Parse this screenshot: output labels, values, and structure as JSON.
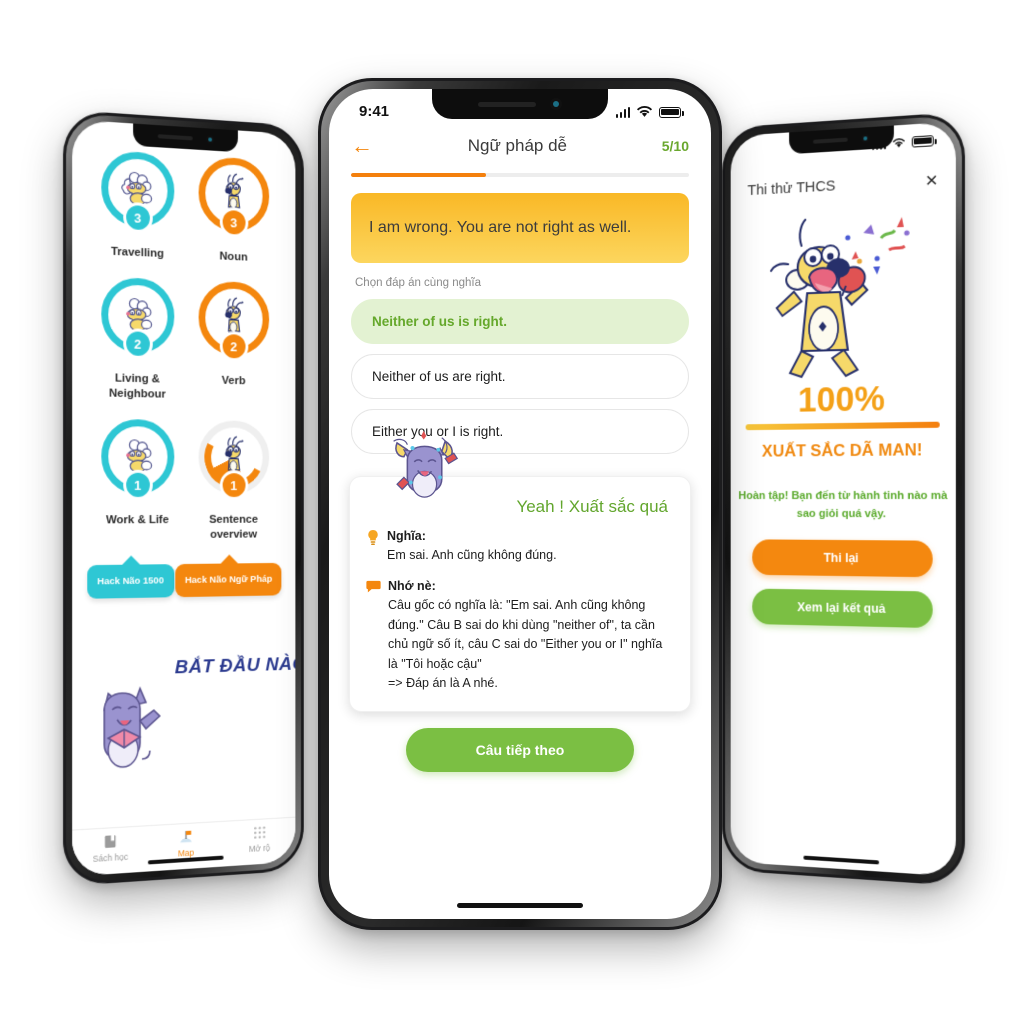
{
  "left_phone": {
    "screen_name": "map-screen",
    "nodes": [
      {
        "label": "Travelling",
        "badge": "3",
        "color": "#2ec7d4",
        "state": "complete",
        "mascot": "sheep-icon"
      },
      {
        "label": "Noun",
        "badge": "3",
        "color": "#f4870e",
        "state": "complete",
        "mascot": "dog-icon"
      },
      {
        "label": "Living & Neighbour",
        "badge": "2",
        "color": "#2ec7d4",
        "state": "complete",
        "mascot": "sheep-icon"
      },
      {
        "label": "Verb",
        "badge": "2",
        "color": "#f4870e",
        "state": "complete",
        "mascot": "dog-icon"
      },
      {
        "label": "Work & Life",
        "badge": "1",
        "color": "#2ec7d4",
        "state": "complete",
        "mascot": "sheep-icon"
      },
      {
        "label": "Sentence overview",
        "badge": "1",
        "color": "#f4870e",
        "state": "partial",
        "mascot": "dog-icon"
      }
    ],
    "tags": [
      {
        "label": "Hack Não 1500",
        "color": "#2ec7d4"
      },
      {
        "label": "Hack Não Ngữ Pháp",
        "color": "#f4870e"
      }
    ],
    "start_title": "BẮT ĐẦU NÀO",
    "tabs": [
      {
        "label": "Sách học",
        "icon": "book-icon",
        "active": false
      },
      {
        "label": "Map",
        "icon": "flag-icon",
        "active": true
      },
      {
        "label": "Mở rộ",
        "icon": "grid-icon",
        "active": false
      }
    ]
  },
  "center_phone": {
    "status": {
      "time": "9:41",
      "signal": "signal-icon",
      "wifi": "wifi-icon",
      "battery": "battery-icon"
    },
    "header": {
      "back": "←",
      "title": "Ngữ pháp dễ",
      "counter": "5/10",
      "progress_percent": 40
    },
    "question": {
      "prompt": "I am wrong. You are not right as well.",
      "hint": "Chọn đáp án cùng nghĩa"
    },
    "options": [
      {
        "text": "Neither of us is right.",
        "correct": true
      },
      {
        "text": "Neither of us are right.",
        "correct": false
      },
      {
        "text": "Either you or I is right.",
        "correct": false
      }
    ],
    "explanation": {
      "headline": "Yeah ! Xuất sắc quá",
      "meaning_label": "Nghĩa:",
      "meaning_text": "Em sai. Anh cũng không đúng.",
      "note_label": "Nhớ nè:",
      "note_text": "Câu gốc có nghĩa là: \"Em sai. Anh cũng không đúng.\" Câu B sai do khi dùng \"neither of\", ta cần chủ ngữ số ít, câu C sai do \"Either you or I\" nghĩa là \"Tôi hoặc cậu\"\n=> Đáp án là A nhé.",
      "meaning_icon": "lightbulb-icon",
      "note_icon": "speech-bubble-icon",
      "mascot": "cat-celebrating-icon"
    },
    "next_button": "Câu tiếp theo"
  },
  "right_phone": {
    "header": {
      "title": "Thi thử THCS",
      "close": "×"
    },
    "mascot": "dog-celebrating-icon",
    "score": {
      "percent": "100%",
      "bar_percent": 100,
      "rating": "XUẤT SẮC DÃ MAN!"
    },
    "message": "Hoàn tập! Bạn đến từ hành tinh nào mà sao giỏi quá vậy.",
    "buttons": [
      {
        "label": "Thi lại",
        "color": "#f4880f"
      },
      {
        "label": "Xem lại kết quả",
        "color": "#7bbf43"
      }
    ]
  },
  "colors": {
    "orange": "#f4870e",
    "teal": "#2ec7d4",
    "green": "#7bbf43",
    "yellow": "#f9b826",
    "navy": "#2b3a8f"
  }
}
